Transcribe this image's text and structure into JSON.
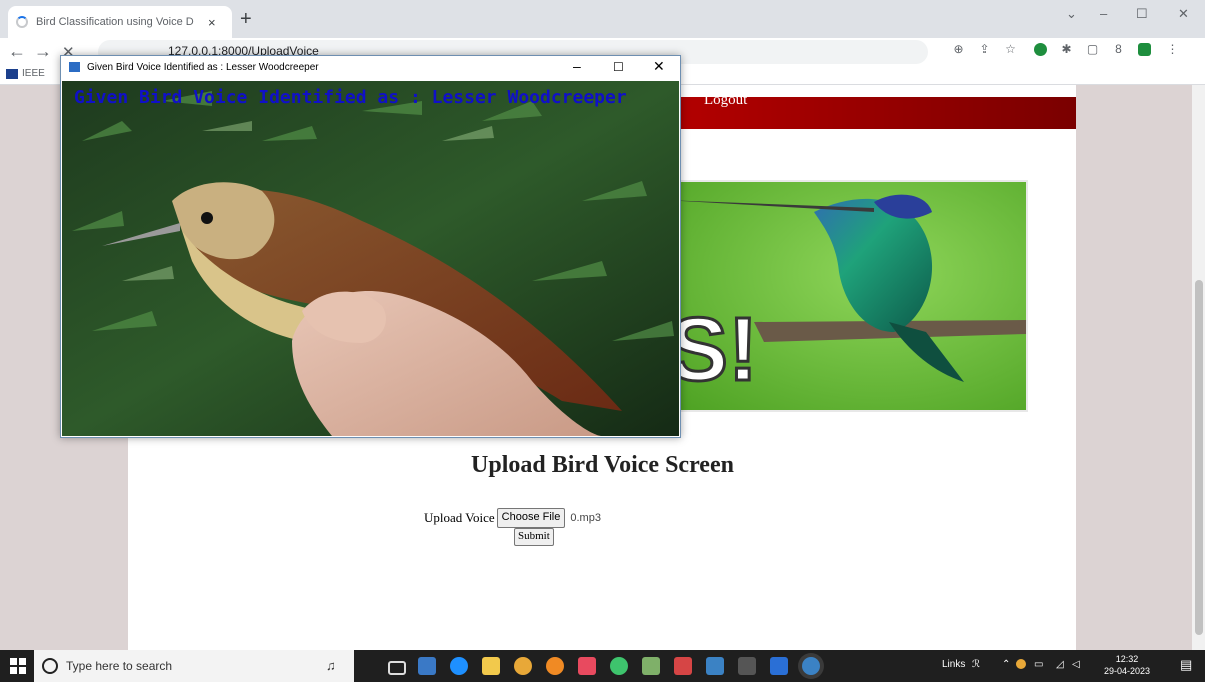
{
  "browser": {
    "tab_title": "Bird Classification using Voice D",
    "tab_close": "×",
    "new_tab": "+",
    "url": "127.0.0.1:8000/UploadVoice",
    "bookmark": "IEEE"
  },
  "page": {
    "nav_logout": "Logout",
    "banner_text": "S!",
    "upload_title": "Upload Bird Voice Screen",
    "upload_label": "Upload Voice",
    "choose_file": "Choose File",
    "file_name": "0.mp3",
    "submit": "Submit"
  },
  "popup": {
    "title": "Given Bird Voice Identified as : Lesser Woodcreeper",
    "overlay_text": "Given Bird Voice Identified as : Lesser Woodcreeper",
    "minimize": "–",
    "maximize": "☐",
    "close": "✕"
  },
  "taskbar": {
    "search_placeholder": "Type here to search",
    "links_label": "Links",
    "time": "12:32",
    "date": "29-04-2023"
  },
  "colors": {
    "nav_red": "#b00000",
    "overlay_text": "#1010c8",
    "banner_green": "#6bbf3a"
  }
}
